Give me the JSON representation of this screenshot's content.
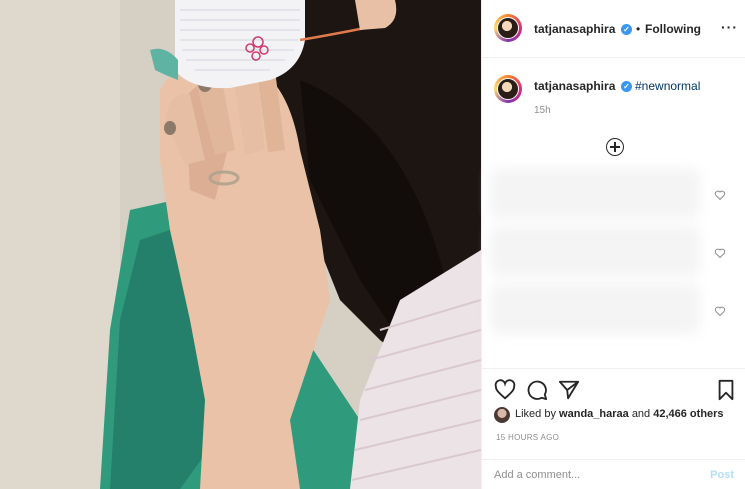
{
  "post": {
    "username": "tatjanasaphira",
    "verified_icon": "verified-badge-icon",
    "separator": "•",
    "follow_status": "Following",
    "more_icon": "more-options-icon"
  },
  "caption": {
    "username": "tatjanasaphira",
    "hashtag": "#newnormal",
    "age": "15h"
  },
  "comments_area": {
    "load_more_icon": "plus-circle-icon",
    "comment_like_icons": [
      "heart-outline-icon",
      "heart-outline-icon",
      "heart-outline-icon"
    ]
  },
  "actions": {
    "like_icon": "heart-outline-icon",
    "comment_icon": "comment-bubble-icon",
    "share_icon": "paper-plane-icon",
    "save_icon": "bookmark-icon"
  },
  "likes": {
    "prefix": "Liked by",
    "liker": "wanda_haraa",
    "conjunction": "and",
    "others": "42,466 others"
  },
  "timestamp": "15 HOURS AGO",
  "comment_box": {
    "placeholder": "Add a comment...",
    "post_label": "Post"
  },
  "colors": {
    "link": "#00376b",
    "verified": "#3897f0",
    "post_disabled": "#b2dffc"
  }
}
